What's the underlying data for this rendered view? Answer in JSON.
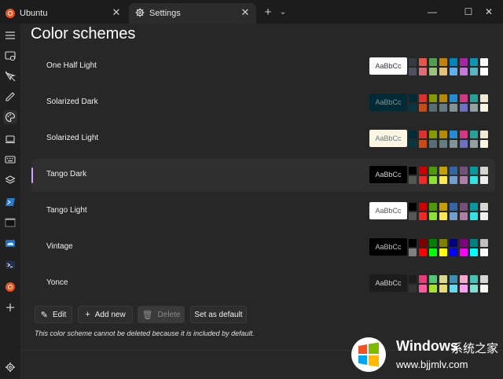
{
  "titlebar": {
    "tabs": [
      {
        "label": "Ubuntu",
        "icon": "ubuntu-icon"
      },
      {
        "label": "Settings",
        "icon": "gear-icon"
      }
    ],
    "close_glyph": "✕",
    "newtab_glyph": "+",
    "dropdown_glyph": "⌄",
    "min_glyph": "—",
    "max_glyph": "☐",
    "winclose_glyph": "✕"
  },
  "sidebar": {
    "items": [
      {
        "name": "hamburger-menu-icon"
      },
      {
        "name": "startup-icon"
      },
      {
        "name": "interaction-icon"
      },
      {
        "name": "appearance-icon"
      },
      {
        "name": "color-schemes-icon"
      },
      {
        "name": "rendering-icon"
      },
      {
        "name": "actions-icon"
      },
      {
        "name": "defaults-icon"
      },
      {
        "name": "powershell-icon"
      },
      {
        "name": "command-prompt-icon"
      },
      {
        "name": "azure-cloud-shell-icon"
      },
      {
        "name": "powershell-core-icon"
      },
      {
        "name": "ubuntu-profile-icon"
      },
      {
        "name": "add-profile-icon"
      },
      {
        "name": "open-json-settings-icon"
      }
    ]
  },
  "main": {
    "title": "Color schemes",
    "preview_text": "AaBbCc",
    "schemes": [
      {
        "name": "One Half Light",
        "preview_bg": "#fafafa",
        "preview_fg": "#383a42",
        "colors": [
          "#383a42",
          "#e45649",
          "#50a14f",
          "#c18301",
          "#0184bc",
          "#a626a4",
          "#0997b3",
          "#fafafa",
          "#4f525e",
          "#e06c75",
          "#98c379",
          "#e5c07b",
          "#61afef",
          "#c678dd",
          "#56b6c2",
          "#ffffff"
        ]
      },
      {
        "name": "Solarized Dark",
        "preview_bg": "#002b36",
        "preview_fg": "#839496",
        "colors": [
          "#002b36",
          "#dc322f",
          "#859900",
          "#b58900",
          "#268bd2",
          "#d33682",
          "#2aa198",
          "#eee8d5",
          "#073642",
          "#cb4b16",
          "#586e75",
          "#657b83",
          "#839496",
          "#6c71c4",
          "#93a1a1",
          "#fdf6e3"
        ]
      },
      {
        "name": "Solarized Light",
        "preview_bg": "#fdf6e3",
        "preview_fg": "#657b83",
        "colors": [
          "#002b36",
          "#dc322f",
          "#859900",
          "#b58900",
          "#268bd2",
          "#d33682",
          "#2aa198",
          "#eee8d5",
          "#073642",
          "#cb4b16",
          "#586e75",
          "#657b83",
          "#839496",
          "#6c71c4",
          "#93a1a1",
          "#fdf6e3"
        ]
      },
      {
        "name": "Tango Dark",
        "preview_bg": "#000000",
        "preview_fg": "#d3d7cf",
        "selected": true,
        "colors": [
          "#000000",
          "#cc0000",
          "#4e9a06",
          "#c4a000",
          "#3465a4",
          "#75507b",
          "#06989a",
          "#d3d7cf",
          "#555753",
          "#ef2929",
          "#8ae234",
          "#fce94f",
          "#729fcf",
          "#ad7fa8",
          "#34e2e2",
          "#eeeeec"
        ]
      },
      {
        "name": "Tango Light",
        "preview_bg": "#ffffff",
        "preview_fg": "#555753",
        "colors": [
          "#000000",
          "#cc0000",
          "#4e9a06",
          "#c4a000",
          "#3465a4",
          "#75507b",
          "#06989a",
          "#d3d7cf",
          "#555753",
          "#ef2929",
          "#8ae234",
          "#fce94f",
          "#729fcf",
          "#ad7fa8",
          "#34e2e2",
          "#eeeeec"
        ]
      },
      {
        "name": "Vintage",
        "preview_bg": "#000000",
        "preview_fg": "#c0c0c0",
        "colors": [
          "#000000",
          "#800000",
          "#008000",
          "#808000",
          "#000080",
          "#800080",
          "#008080",
          "#c0c0c0",
          "#808080",
          "#ff0000",
          "#00ff00",
          "#ffff00",
          "#0000ff",
          "#ff00ff",
          "#00ffff",
          "#ffffff"
        ]
      },
      {
        "name": "Yonce",
        "preview_bg": "#1c1c1c",
        "preview_fg": "#d4d4d4",
        "colors": [
          "#1c1c1c",
          "#e83b79",
          "#50c878",
          "#d8d88c",
          "#3e8fb0",
          "#f5a7c9",
          "#46c2b4",
          "#d4d4d4",
          "#343434",
          "#ff5a9e",
          "#a6e22e",
          "#e6db74",
          "#66d9ef",
          "#ff9ff3",
          "#7fe0d0",
          "#f8f8f2"
        ]
      }
    ],
    "buttons": {
      "edit": "Edit",
      "add_new": "Add new",
      "delete": "Delete",
      "set_default": "Set as default"
    },
    "note": "This color scheme cannot be deleted because it is included by default."
  },
  "watermark": {
    "brand": "Windows",
    "cn": "系统之家",
    "url": "www.bjjmlv.com"
  }
}
